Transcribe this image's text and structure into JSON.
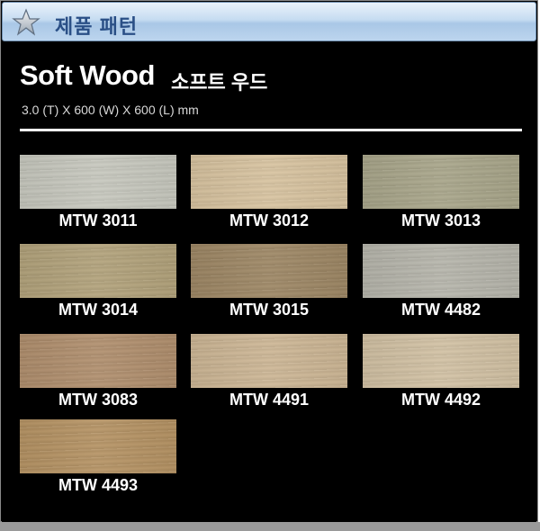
{
  "header": {
    "title": "제품 패턴",
    "icon": "star-icon"
  },
  "product": {
    "name": "Soft Wood",
    "name_kr": "소프트 우드",
    "dimensions": "3.0 (T) X 600 (W) X 600 (L) mm"
  },
  "patterns": [
    {
      "code": "MTW 3011",
      "color": "#c7c8be"
    },
    {
      "code": "MTW 3012",
      "color": "#d8c39f"
    },
    {
      "code": "MTW 3013",
      "color": "#a8a589"
    },
    {
      "code": "MTW 3014",
      "color": "#b2a27a"
    },
    {
      "code": "MTW 3015",
      "color": "#9d8663"
    },
    {
      "code": "MTW 4482",
      "color": "#b6b5ab"
    },
    {
      "code": "MTW 3083",
      "color": "#b08e6c"
    },
    {
      "code": "MTW 4491",
      "color": "#cdb694"
    },
    {
      "code": "MTW 4492",
      "color": "#d2c1a3"
    },
    {
      "code": "MTW 4493",
      "color": "#b59262"
    }
  ]
}
